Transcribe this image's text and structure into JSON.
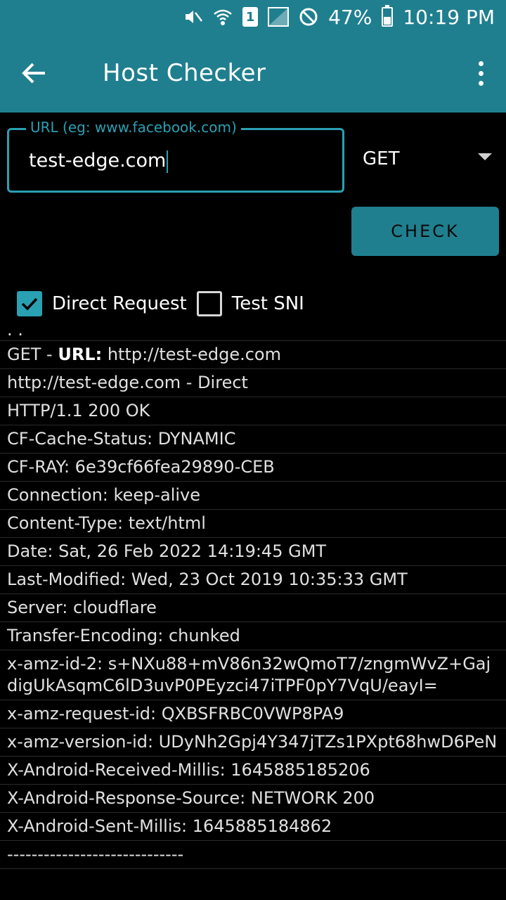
{
  "status_bar": {
    "sim": "1",
    "battery": "47%",
    "battery_level": 0.47,
    "time": "10:19 PM"
  },
  "app_bar": {
    "title": "Host Checker"
  },
  "form": {
    "url_label": "URL (eg: www.facebook.com)",
    "url_value": "test-edge.com",
    "method": "GET",
    "check_label": "CHECK",
    "direct_request_label": "Direct Request",
    "direct_request_checked": true,
    "test_sni_label": "Test SNI",
    "test_sni_checked": false
  },
  "log": {
    "top_fragment": ". .",
    "first_prefix": "GET - ",
    "first_bold": "URL:",
    "first_value": " http://test-edge.com",
    "lines": [
      "http://test-edge.com - Direct",
      "HTTP/1.1 200 OK",
      "CF-Cache-Status: DYNAMIC",
      "CF-RAY: 6e39cf66fea29890-CEB",
      "Connection: keep-alive",
      "Content-Type: text/html",
      "Date: Sat, 26 Feb 2022 14:19:45 GMT",
      "Last-Modified: Wed, 23 Oct 2019 10:35:33 GMT",
      "Server: cloudflare",
      "Transfer-Encoding: chunked",
      "x-amz-id-2: s+NXu88+mV86n32wQmoT7/zngmWvZ+GajdigUkAsqmC6lD3uvP0PEyzci47iTPF0pY7VqU/eayI=",
      "x-amz-request-id: QXBSFRBC0VWP8PA9",
      "x-amz-version-id: UDyNh2Gpj4Y347jTZs1PXpt68hwD6PeN",
      "X-Android-Received-Millis: 1645885185206",
      "X-Android-Response-Source: NETWORK 200",
      "X-Android-Sent-Millis: 1645885184862",
      "-----------------------------"
    ]
  }
}
